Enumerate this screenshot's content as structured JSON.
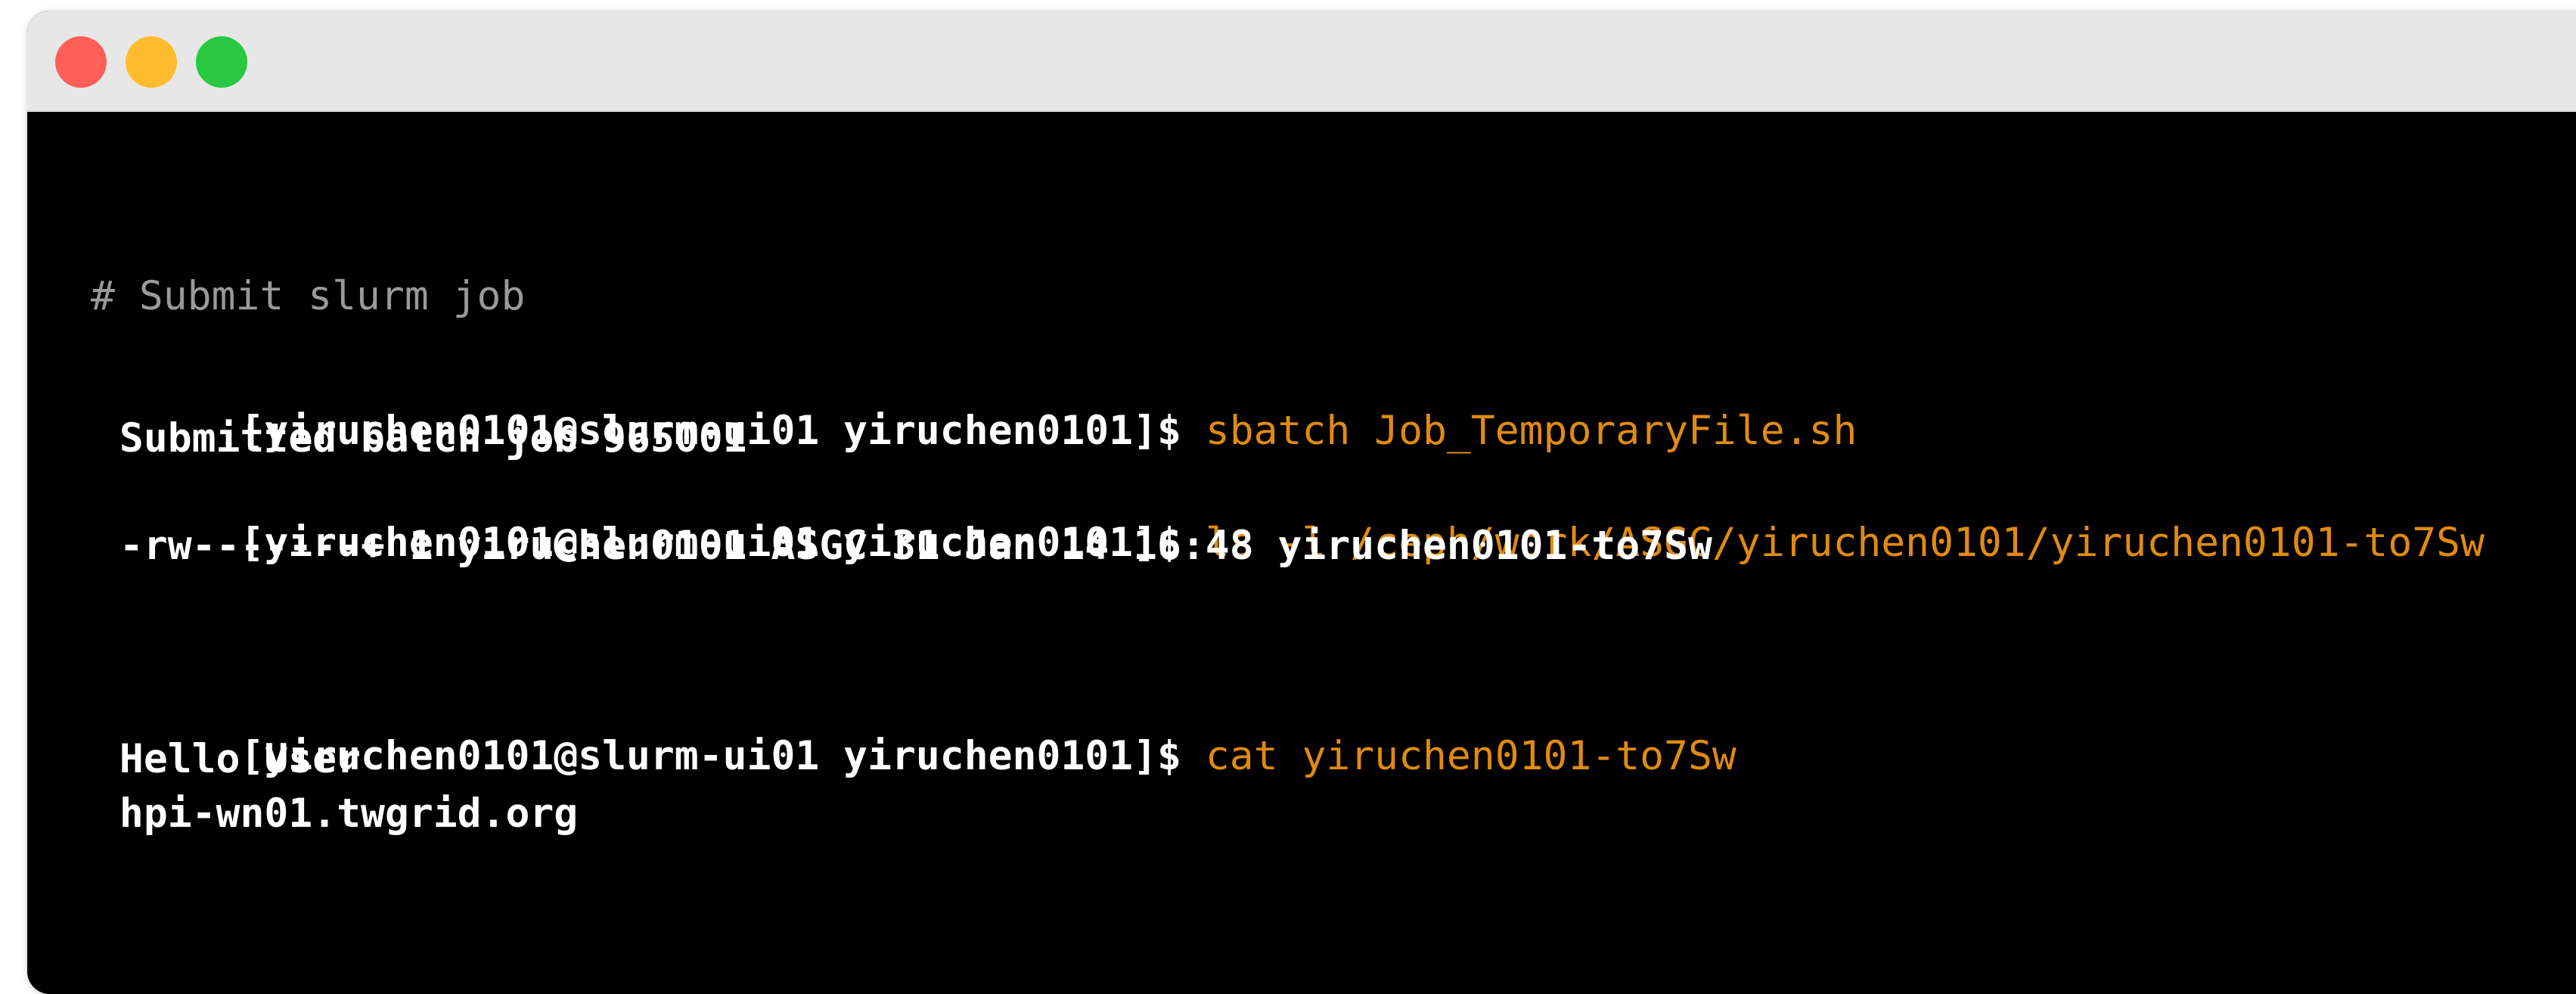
{
  "window": {
    "controls": {
      "close": "close-button",
      "minimize": "minimize-button",
      "zoom": "zoom-button"
    }
  },
  "terminal": {
    "comment": "# Submit slurm job",
    "prompt": "[yiruchen0101@slurm-ui01 yiruchen0101]$ ",
    "commands": [
      "sbatch Job_TemporaryFile.sh",
      "ls -l /ceph/work/ASGC/yiruchen0101/yiruchen0101-to7Sw",
      "cat yiruchen0101-to7Sw"
    ],
    "outputs": [
      " Submitted batch job 965001",
      " -rw-------+ 1 yiruchen0101 ASGC 31 Jan 14 16:48 yiruchen0101-to7Sw",
      " Hello User",
      " hpi-wn01.twgrid.org"
    ]
  },
  "colors": {
    "background": "#000000",
    "titlebar": "#e7e7e7",
    "command": "#e08b10",
    "comment": "#9a9a9a",
    "text": "#ffffff"
  }
}
